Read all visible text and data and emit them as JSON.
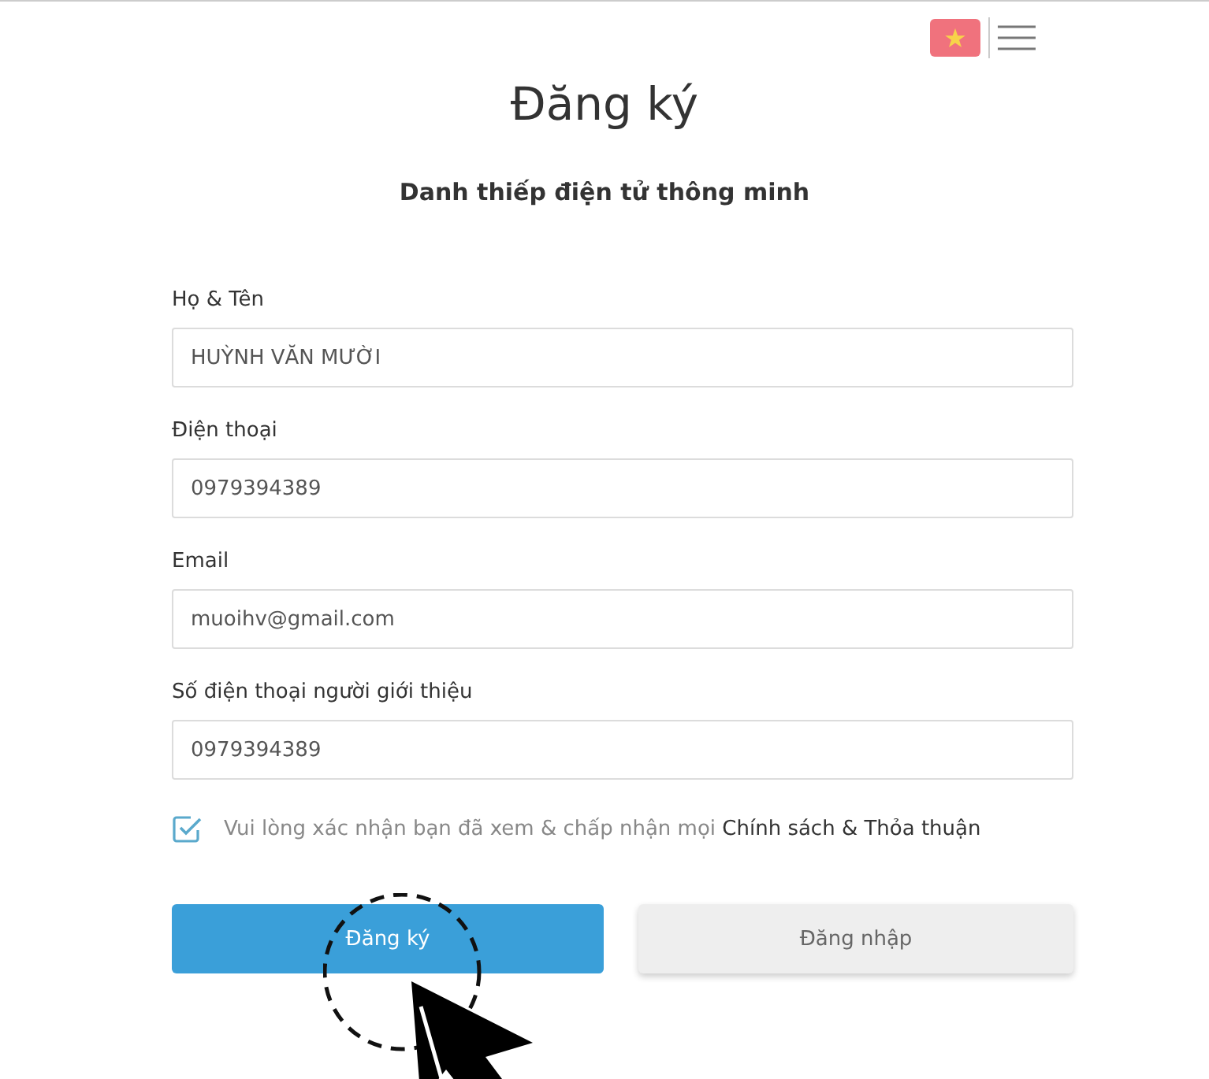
{
  "title": "Đăng ký",
  "subtitle": "Danh thiếp điện tử thông minh",
  "fields": [
    {
      "label": "Họ & Tên",
      "value": "HUỲNH VĂN MƯỜI"
    },
    {
      "label": "Điện thoại",
      "value": "0979394389"
    },
    {
      "label": "Email",
      "value": "muoihv@gmail.com"
    },
    {
      "label": "Số điện thoại người giới thiệu",
      "value": "0979394389"
    }
  ],
  "consent": {
    "checked": true,
    "text": "Vui lòng xác nhận bạn đã xem & chấp nhận mọi",
    "link": "Chính sách & Thỏa thuận"
  },
  "buttons": [
    {
      "label": "Đăng ký",
      "kind": "primary"
    },
    {
      "label": "Đăng nhập",
      "kind": "secondary"
    }
  ]
}
